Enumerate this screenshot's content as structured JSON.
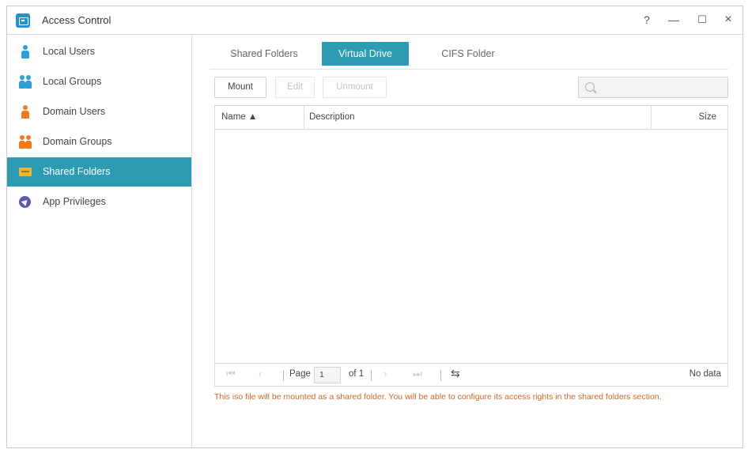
{
  "window": {
    "title": "Access Control",
    "help_glyph": "?",
    "minimize_glyph": "—",
    "maximize_glyph": "☐",
    "close_glyph": "×"
  },
  "sidebar": {
    "items": [
      {
        "label": "Local Users",
        "icon": "user-icon",
        "color": "#2a9fd8"
      },
      {
        "label": "Local Groups",
        "icon": "group-icon",
        "color": "#2a9fd8"
      },
      {
        "label": "Domain Users",
        "icon": "user-icon",
        "color": "#f07a1e"
      },
      {
        "label": "Domain Groups",
        "icon": "group-icon",
        "color": "#f07a1e"
      },
      {
        "label": "Shared Folders",
        "icon": "folder-icon",
        "color": "#e8b83a",
        "active": true
      },
      {
        "label": "App Privileges",
        "icon": "app-icon",
        "color": "#5a5ab0"
      }
    ]
  },
  "tabs": [
    {
      "label": "Shared Folders",
      "active": false
    },
    {
      "label": "Virtual Drive",
      "active": true
    },
    {
      "label": "CIFS Folder",
      "active": false
    }
  ],
  "toolbar": {
    "mount_label": "Mount",
    "edit_label": "Edit",
    "unmount_label": "Unmount",
    "search_placeholder": ""
  },
  "grid": {
    "columns": [
      "Name ▲",
      "Description",
      "Size"
    ]
  },
  "pager": {
    "page_label": "Page",
    "page_value": "1",
    "of_label": "of 1",
    "status": "No data"
  },
  "note": "This iso file will be mounted as a shared folder. You will be able to configure its access rights in the shared folders section.",
  "colors": {
    "accent": "#2e9bb4",
    "note": "#c86a2a"
  }
}
